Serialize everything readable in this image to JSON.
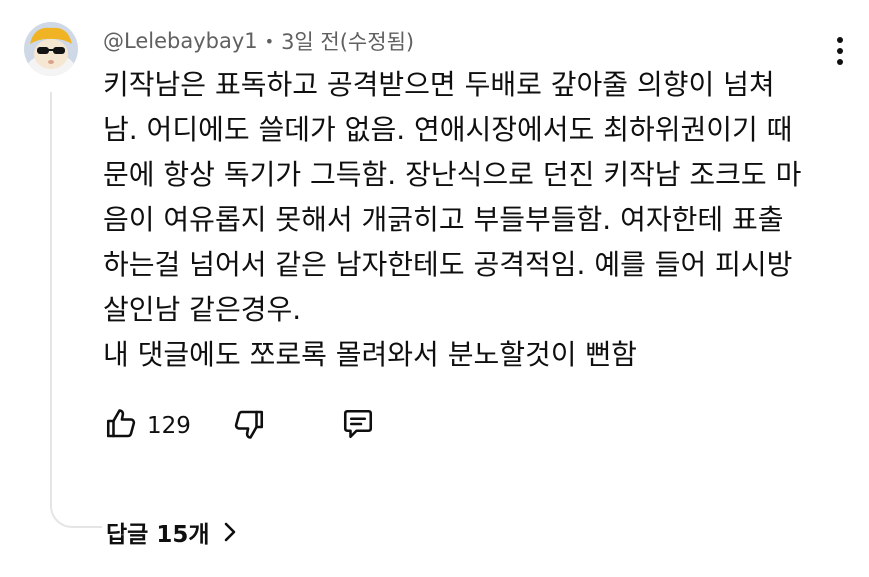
{
  "comment": {
    "author": "@Lelebaybay1",
    "separator": "•",
    "time": "3일 전(수정됨)",
    "lines": [
      "키작남은 표독하고 공격받으면 두배로 갚아줄 의향이 넘쳐",
      "남. 어디에도 쓸데가 없음. 연애시장에서도 최하위권이기 때",
      "문에 항상 독기가 그득함. 장난식으로 던진 키작남 조크도 마",
      "음이 여유롭지 못해서 개긁히고 부들부들함. 여자한테 표출",
      "하는걸 넘어서 같은 남자한테도 공격적임. 예를 들어 피시방",
      "살인남 같은경우.",
      "내 댓글에도 쪼로록 몰려와서 분노할것이 뻔함"
    ],
    "like_count": "129",
    "replies_label": "답글 15개"
  },
  "icons": {
    "avatar": "avatar-cat-with-hat",
    "more": "more-vert-icon",
    "like": "thumb-up-icon",
    "dislike": "thumb-down-icon",
    "reply": "reply-comment-icon",
    "chevron": "chevron-right-icon"
  },
  "colors": {
    "text": "#0f0f0f",
    "meta": "#606060",
    "thread_line": "#e5e5e5",
    "background": "#ffffff"
  }
}
